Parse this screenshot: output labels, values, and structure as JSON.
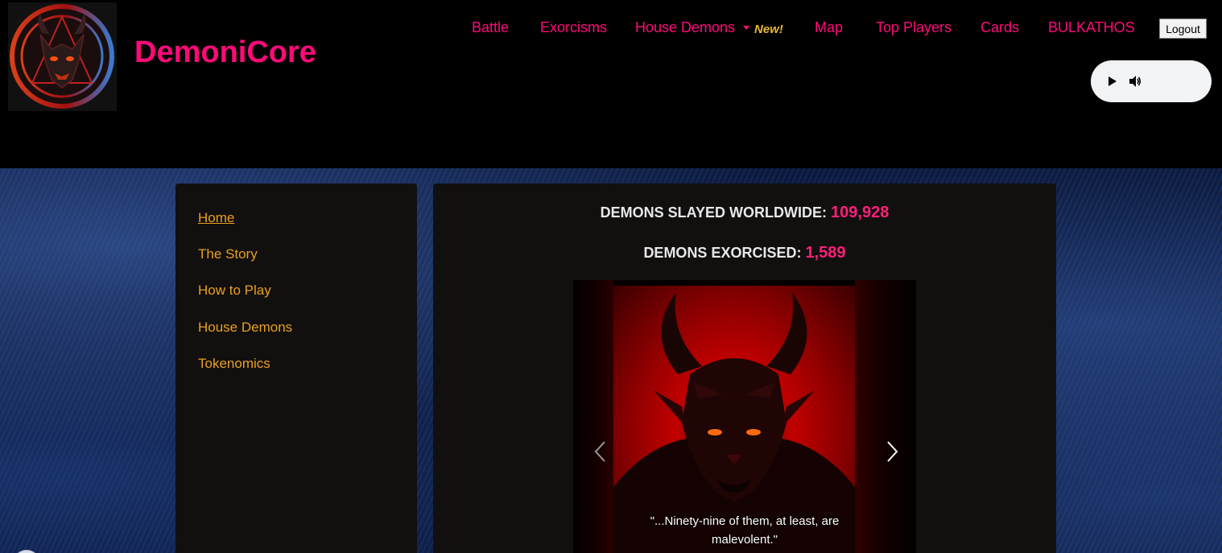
{
  "brand": {
    "name": "DemoniCore",
    "logo_icon": "demon-emblem-icon"
  },
  "nav": {
    "items": [
      {
        "label": "Battle"
      },
      {
        "label": "Exorcisms"
      },
      {
        "label": "House Demons",
        "badge": "New!",
        "has_dropdown": true
      },
      {
        "label": "Map"
      },
      {
        "label": "Top Players"
      },
      {
        "label": "Cards"
      },
      {
        "label": "BULKATHOS"
      }
    ],
    "logout_label": "Logout"
  },
  "audio": {
    "play_icon": "play-icon",
    "volume_icon": "volume-icon"
  },
  "sidebar": {
    "items": [
      {
        "label": "Home",
        "active": true
      },
      {
        "label": "The Story"
      },
      {
        "label": "How to Play"
      },
      {
        "label": "House Demons"
      },
      {
        "label": "Tokenomics"
      }
    ]
  },
  "stats": {
    "slayed_label": "DEMONS SLAYED WORLDWIDE:",
    "slayed_value": "109,928",
    "exorcised_label": "DEMONS EXORCISED:",
    "exorcised_value": "1,589"
  },
  "carousel": {
    "caption_line1": "\"...Ninety-nine of them, at least, are",
    "caption_line2": "malevolent.\"",
    "prev_icon": "chevron-left-icon",
    "next_icon": "chevron-right-icon"
  },
  "colors": {
    "brand_pink": "#ff0a78",
    "sidebar_link": "#e8a020",
    "badge_gold": "#e6b830",
    "panel_bg": "#120f0f"
  }
}
